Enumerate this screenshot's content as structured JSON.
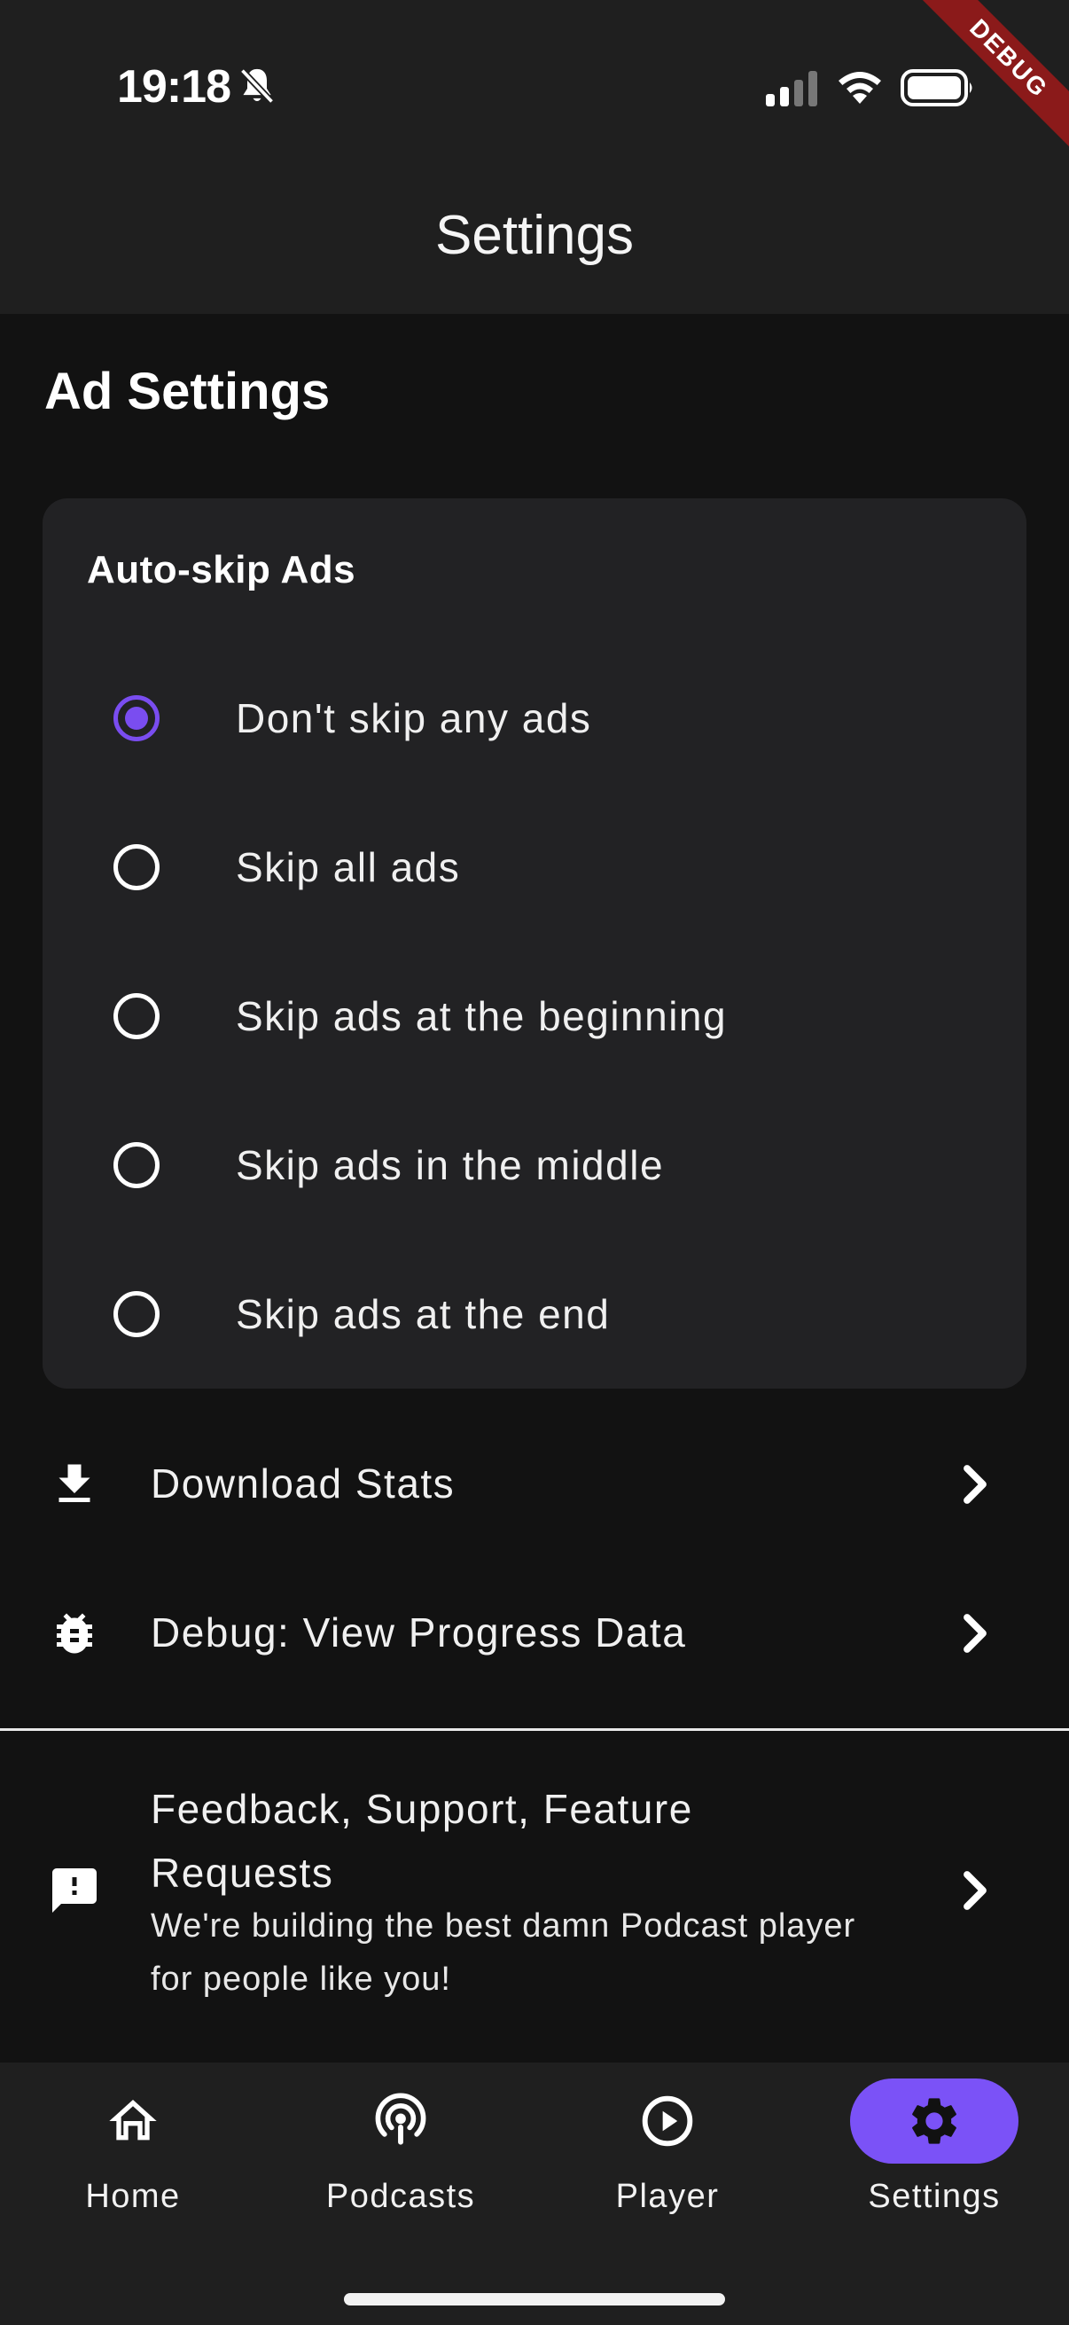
{
  "status_bar": {
    "time": "19:18"
  },
  "debug_banner": "DEBUG",
  "app_bar": {
    "title": "Settings"
  },
  "section_title": "Ad Settings",
  "auto_skip": {
    "title": "Auto-skip Ads",
    "selected_index": 0,
    "options": [
      "Don't skip any ads",
      "Skip all ads",
      "Skip ads at the beginning",
      "Skip ads in the middle",
      "Skip ads at the end"
    ]
  },
  "list": {
    "download_stats": "Download Stats",
    "debug_progress": "Debug: View Progress Data",
    "feedback_title": "Feedback, Support, Feature Requests",
    "feedback_subtitle": "We're building the best damn Podcast player for people like you!"
  },
  "bottom_nav": {
    "active": "settings",
    "items": [
      {
        "id": "home",
        "label": "Home",
        "icon": "home-icon"
      },
      {
        "id": "podcasts",
        "label": "Podcasts",
        "icon": "podcast-icon"
      },
      {
        "id": "player",
        "label": "Player",
        "icon": "play-circle-icon"
      },
      {
        "id": "settings",
        "label": "Settings",
        "icon": "gear-icon"
      }
    ]
  },
  "colors": {
    "accent": "#7b52f7",
    "radio_selected": "#7a4df0",
    "background": "#121212",
    "surface": "#222224",
    "bar": "#1f1f1f",
    "debug": "#8b1a1a"
  }
}
